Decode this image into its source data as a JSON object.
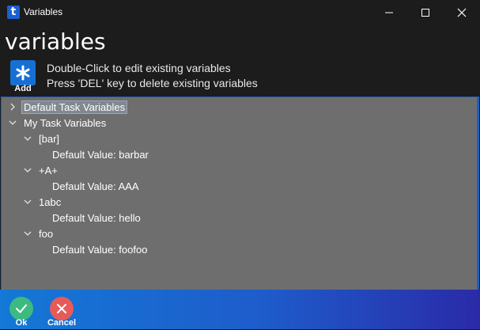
{
  "window": {
    "title": "Variables",
    "app_icon_letter": "t",
    "accent": "#1b5fd0"
  },
  "header": {
    "title": "variables",
    "add_label": "Add",
    "hint_line1": "Double-Click to edit existing variables",
    "hint_line2": "Press 'DEL' key to delete existing variables"
  },
  "tree": {
    "groups": [
      {
        "label": "Default Task Variables",
        "expanded": false,
        "selected": true
      },
      {
        "label": "My Task Variables",
        "expanded": true,
        "variables": [
          {
            "name": "[bar]",
            "default": "Default Value: barbar"
          },
          {
            "name": "+A+",
            "default": "Default Value: AAA"
          },
          {
            "name": "1abc",
            "default": "Default Value: hello"
          },
          {
            "name": "foo",
            "default": "Default Value: foofoo"
          }
        ]
      }
    ]
  },
  "footer": {
    "ok_label": "Ok",
    "cancel_label": "Cancel",
    "ok_color": "#3cba82",
    "cancel_color": "#e85a5a"
  }
}
